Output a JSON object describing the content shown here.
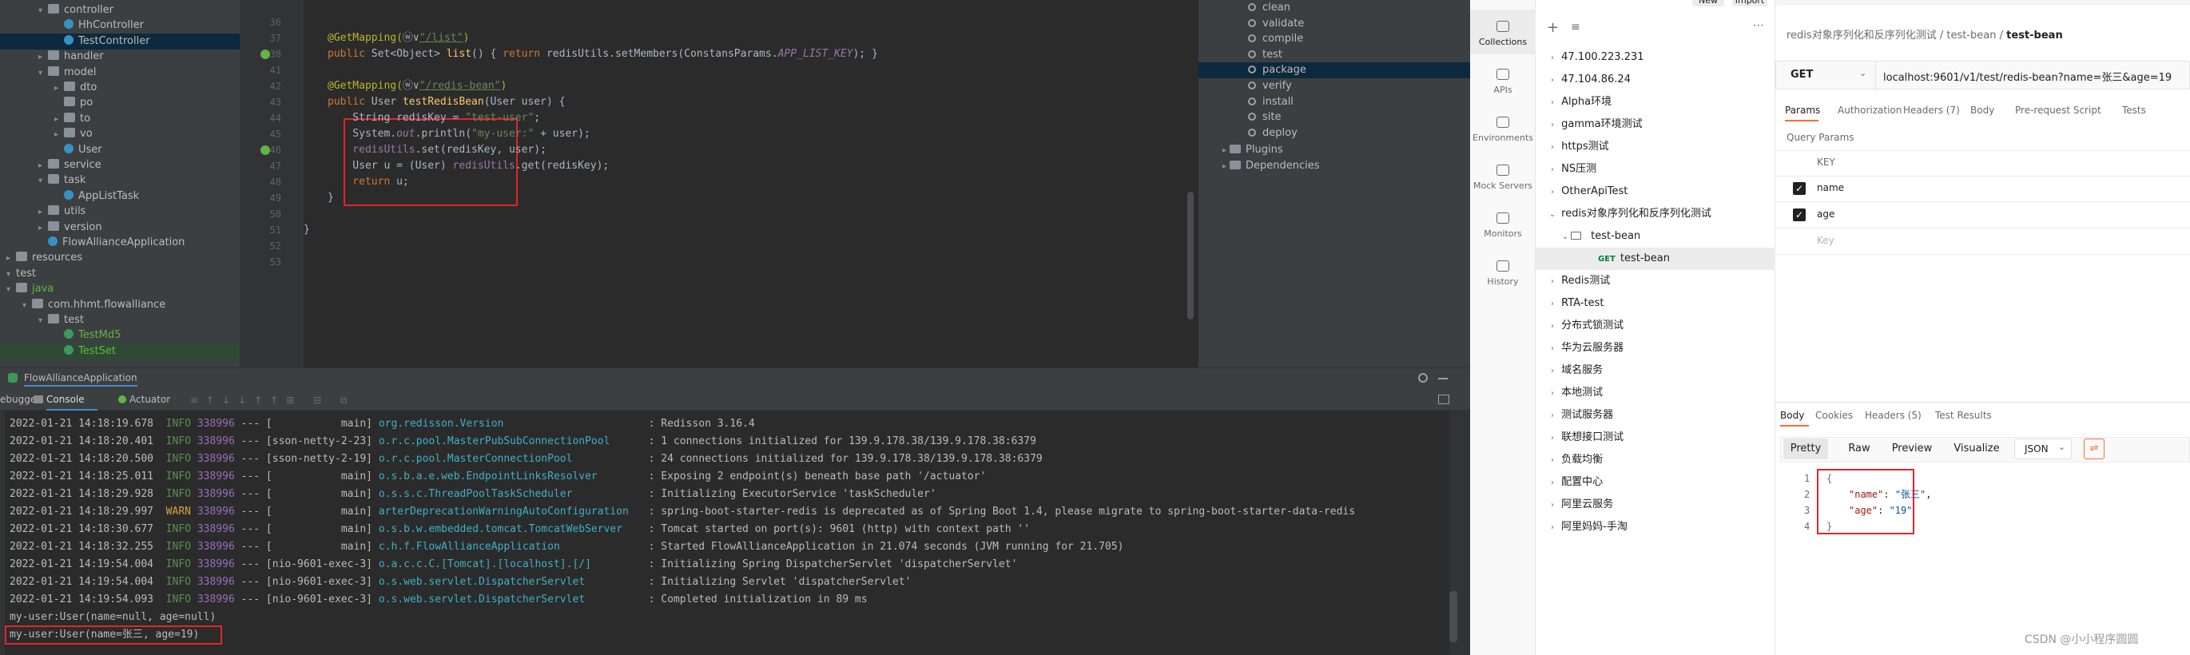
{
  "project_tree": [
    {
      "label": "controller",
      "depth": 2,
      "type": "folder",
      "arrow": "▾"
    },
    {
      "label": "HhController",
      "depth": 3,
      "type": "class",
      "arrow": ""
    },
    {
      "label": "TestController",
      "depth": 3,
      "type": "class",
      "arrow": "",
      "selected": true
    },
    {
      "label": "handler",
      "depth": 2,
      "type": "folder",
      "arrow": "▸"
    },
    {
      "label": "model",
      "depth": 2,
      "type": "folder",
      "arrow": "▾"
    },
    {
      "label": "dto",
      "depth": 3,
      "type": "folder",
      "arrow": "▸"
    },
    {
      "label": "po",
      "depth": 3,
      "type": "folder",
      "arrow": ""
    },
    {
      "label": "to",
      "depth": 3,
      "type": "folder",
      "arrow": "▸"
    },
    {
      "label": "vo",
      "depth": 3,
      "type": "folder",
      "arrow": "▸"
    },
    {
      "label": "User",
      "depth": 3,
      "type": "class",
      "arrow": ""
    },
    {
      "label": "service",
      "depth": 2,
      "type": "folder",
      "arrow": "▸"
    },
    {
      "label": "task",
      "depth": 2,
      "type": "folder",
      "arrow": "▾"
    },
    {
      "label": "AppListTask",
      "depth": 3,
      "type": "class",
      "arrow": ""
    },
    {
      "label": "utils",
      "depth": 2,
      "type": "folder",
      "arrow": "▸"
    },
    {
      "label": "version",
      "depth": 2,
      "type": "folder",
      "arrow": "▸"
    },
    {
      "label": "FlowAllianceApplication",
      "depth": 2,
      "type": "class",
      "arrow": ""
    },
    {
      "label": "resources",
      "depth": 0,
      "type": "folder",
      "arrow": "▸"
    },
    {
      "label": "test",
      "depth": 0,
      "type": "plain",
      "arrow": "▾"
    },
    {
      "label": "java",
      "depth": 0,
      "type": "folder-green",
      "arrow": "▾"
    },
    {
      "label": "com.hhmt.flowalliance",
      "depth": 1,
      "type": "folder",
      "arrow": "▾"
    },
    {
      "label": "test",
      "depth": 2,
      "type": "folder",
      "arrow": "▾"
    },
    {
      "label": "TestMd5",
      "depth": 3,
      "type": "class-green",
      "arrow": ""
    },
    {
      "label": "TestSet",
      "depth": 3,
      "type": "class-green",
      "arrow": ""
    }
  ],
  "editor": {
    "line_numbers": [
      "36",
      "37",
      "38",
      "41",
      "42",
      "43",
      "44",
      "45",
      "46",
      "47",
      "48",
      "49",
      "50",
      "51",
      "52",
      "53"
    ],
    "lines": [
      {
        "n": "36",
        "parts": []
      },
      {
        "n": "37",
        "parts": [
          {
            "c": "an",
            "t": "@GetMapping("
          },
          {
            "c": "",
            "t": "ⓦ∨"
          },
          {
            "c": "link",
            "t": "\"/list\""
          },
          {
            "c": "an",
            "t": ")"
          }
        ]
      },
      {
        "n": "38",
        "parts": [
          {
            "c": "kw",
            "t": "public "
          },
          {
            "c": "",
            "t": "Set<Object> "
          },
          {
            "c": "mth",
            "t": "list"
          },
          {
            "c": "",
            "t": "() { "
          },
          {
            "c": "kw",
            "t": "return "
          },
          {
            "c": "",
            "t": "redisUtils.setMembers(ConstansParams."
          },
          {
            "c": "fld",
            "t": "APP_LIST_KEY"
          },
          {
            "c": "",
            "t": "); }"
          }
        ]
      },
      {
        "n": "41",
        "parts": []
      },
      {
        "n": "42",
        "parts": [
          {
            "c": "an",
            "t": "@GetMapping("
          },
          {
            "c": "",
            "t": "ⓦ∨"
          },
          {
            "c": "link",
            "t": "\"/redis-bean\""
          },
          {
            "c": "an",
            "t": ")"
          }
        ]
      },
      {
        "n": "43",
        "parts": [
          {
            "c": "kw",
            "t": "public "
          },
          {
            "c": "",
            "t": "User "
          },
          {
            "c": "mth",
            "t": "testRedisBean"
          },
          {
            "c": "",
            "t": "(User user) {"
          }
        ]
      },
      {
        "n": "44",
        "parts": [
          {
            "c": "",
            "t": "    String redisKey = "
          },
          {
            "c": "str",
            "t": "\"test-user\""
          },
          {
            "c": "",
            "t": ";"
          }
        ]
      },
      {
        "n": "45",
        "parts": [
          {
            "c": "",
            "t": "    System."
          },
          {
            "c": "fld",
            "t": "out"
          },
          {
            "c": "",
            "t": ".println("
          },
          {
            "c": "str",
            "t": "\"my-user:\""
          },
          {
            "c": "",
            "t": " + user);"
          }
        ]
      },
      {
        "n": "46",
        "parts": [
          {
            "c": "var",
            "t": "    redisUtils"
          },
          {
            "c": "",
            "t": ".set(redisKey, user);"
          }
        ]
      },
      {
        "n": "47",
        "parts": [
          {
            "c": "",
            "t": "    User u = (User) "
          },
          {
            "c": "var",
            "t": "redisUtils"
          },
          {
            "c": "",
            "t": ".get(redisKey);"
          }
        ]
      },
      {
        "n": "48",
        "parts": [
          {
            "c": "kw",
            "t": "    return "
          },
          {
            "c": "",
            "t": "u;"
          }
        ]
      },
      {
        "n": "49",
        "parts": [
          {
            "c": "",
            "t": "}"
          }
        ]
      },
      {
        "n": "50",
        "parts": []
      },
      {
        "n": "51",
        "parts": [
          {
            "c": "",
            "t": "}"
          }
        ]
      },
      {
        "n": "52",
        "parts": []
      },
      {
        "n": "53",
        "parts": []
      }
    ]
  },
  "maven": {
    "lifecycle": [
      "clean",
      "validate",
      "compile",
      "test",
      "package",
      "verify",
      "install",
      "site",
      "deploy"
    ],
    "selected": "package",
    "folders": [
      "Plugins",
      "Dependencies"
    ]
  },
  "run": {
    "app_name": "FlowAllianceApplication",
    "tabs": [
      "ebugger",
      "Console",
      "Actuator"
    ]
  },
  "console_lines": [
    {
      "ts": "2022-01-21 14:18:19.678",
      "lvl": "INFO",
      "pid": "338996",
      "thread": "--- [           main]",
      "logger": "org.redisson.Version",
      "msg": ": Redisson 3.16.4"
    },
    {
      "ts": "2022-01-21 14:18:20.401",
      "lvl": "INFO",
      "pid": "338996",
      "thread": "--- [sson-netty-2-23]",
      "logger": "o.r.c.pool.MasterPubSubConnectionPool",
      "msg": ": 1 connections initialized for 139.9.178.38/139.9.178.38:6379"
    },
    {
      "ts": "2022-01-21 14:18:20.500",
      "lvl": "INFO",
      "pid": "338996",
      "thread": "--- [sson-netty-2-19]",
      "logger": "o.r.c.pool.MasterConnectionPool",
      "msg": ": 24 connections initialized for 139.9.178.38/139.9.178.38:6379"
    },
    {
      "ts": "2022-01-21 14:18:25.011",
      "lvl": "INFO",
      "pid": "338996",
      "thread": "--- [           main]",
      "logger": "o.s.b.a.e.web.EndpointLinksResolver",
      "msg": ": Exposing 2 endpoint(s) beneath base path '/actuator'"
    },
    {
      "ts": "2022-01-21 14:18:29.928",
      "lvl": "INFO",
      "pid": "338996",
      "thread": "--- [           main]",
      "logger": "o.s.s.c.ThreadPoolTaskScheduler",
      "msg": ": Initializing ExecutorService 'taskScheduler'"
    },
    {
      "ts": "2022-01-21 14:18:29.997",
      "lvl": "WARN",
      "pid": "338996",
      "thread": "--- [           main]",
      "logger": "arterDeprecationWarningAutoConfiguration",
      "msg": ": spring-boot-starter-redis is deprecated as of Spring Boot 1.4, please migrate to spring-boot-starter-data-redis"
    },
    {
      "ts": "2022-01-21 14:18:30.677",
      "lvl": "INFO",
      "pid": "338996",
      "thread": "--- [           main]",
      "logger": "o.s.b.w.embedded.tomcat.TomcatWebServer",
      "msg": ": Tomcat started on port(s): 9601 (http) with context path ''"
    },
    {
      "ts": "2022-01-21 14:18:32.255",
      "lvl": "INFO",
      "pid": "338996",
      "thread": "--- [           main]",
      "logger": "c.h.f.FlowAllianceApplication",
      "msg": ": Started FlowAllianceApplication in 21.074 seconds (JVM running for 21.705)"
    },
    {
      "ts": "2022-01-21 14:19:54.004",
      "lvl": "INFO",
      "pid": "338996",
      "thread": "--- [nio-9601-exec-3]",
      "logger": "o.a.c.c.C.[Tomcat].[localhost].[/]",
      "msg": ": Initializing Spring DispatcherServlet 'dispatcherServlet'"
    },
    {
      "ts": "2022-01-21 14:19:54.004",
      "lvl": "INFO",
      "pid": "338996",
      "thread": "--- [nio-9601-exec-3]",
      "logger": "o.s.web.servlet.DispatcherServlet",
      "msg": ": Initializing Servlet 'dispatcherServlet'"
    },
    {
      "ts": "2022-01-21 14:19:54.093",
      "lvl": "INFO",
      "pid": "338996",
      "thread": "--- [nio-9601-exec-3]",
      "logger": "o.s.web.servlet.DispatcherServlet",
      "msg": ": Completed initialization in 89 ms"
    }
  ],
  "console_plain": [
    "my-user:User(name=null, age=null)",
    "my-user:User(name=张三, age=19)"
  ],
  "postman": {
    "top_buttons": [
      "New",
      "Import"
    ],
    "side_icons": [
      "Collections",
      "APIs",
      "Environments",
      "Mock Servers",
      "Monitors",
      "History"
    ],
    "collections": [
      {
        "label": "47.100.223.231",
        "level": 0,
        "chev": "›"
      },
      {
        "label": "47.104.86.24",
        "level": 0,
        "chev": "›"
      },
      {
        "label": "Alpha环境",
        "level": 0,
        "chev": "›"
      },
      {
        "label": "gamma环境测试",
        "level": 0,
        "chev": "›"
      },
      {
        "label": "https测试",
        "level": 0,
        "chev": "›"
      },
      {
        "label": "NS压测",
        "level": 0,
        "chev": "›"
      },
      {
        "label": "OtherApiTest",
        "level": 0,
        "chev": "›"
      },
      {
        "label": "redis对象序列化和反序列化测试",
        "level": 0,
        "chev": "⌄"
      },
      {
        "label": "test-bean",
        "level": 1,
        "chev": "⌄"
      },
      {
        "label": "test-bean",
        "level": 2,
        "chev": "",
        "method": "GET"
      },
      {
        "label": "Redis测试",
        "level": 0,
        "chev": "›"
      },
      {
        "label": "RTA-test",
        "level": 0,
        "chev": "›"
      },
      {
        "label": "分布式锁测试",
        "level": 0,
        "chev": "›"
      },
      {
        "label": "华为云服务器",
        "level": 0,
        "chev": "›"
      },
      {
        "label": "域名服务",
        "level": 0,
        "chev": "›"
      },
      {
        "label": "本地测试",
        "level": 0,
        "chev": "›"
      },
      {
        "label": "测试服务器",
        "level": 0,
        "chev": "›"
      },
      {
        "label": "联想接口测试",
        "level": 0,
        "chev": "›"
      },
      {
        "label": "负载均衡",
        "level": 0,
        "chev": "›"
      },
      {
        "label": "配置中心",
        "level": 0,
        "chev": "›"
      },
      {
        "label": "阿里云服务",
        "level": 0,
        "chev": "›"
      },
      {
        "label": "阿里妈妈-手淘",
        "level": 0,
        "chev": "›"
      }
    ],
    "breadcrumb": [
      "redis对象序列化和反序列化测试",
      "/",
      "test-bean",
      "/",
      "test-bean"
    ],
    "method": "GET",
    "url": "localhost:9601/v1/test/redis-bean?name=张三&age=19",
    "req_tabs": [
      "Params",
      "Authorization",
      "Headers (7)",
      "Body",
      "Pre-request Script",
      "Tests"
    ],
    "query_params_title": "Query Params",
    "params_header": "KEY",
    "params": [
      "name",
      "age"
    ],
    "params_placeholder": "Key",
    "resp_tabs": [
      "Body",
      "Cookies",
      "Headers (5)",
      "Test Results"
    ],
    "resp_views": [
      "Pretty",
      "Raw",
      "Preview",
      "Visualize"
    ],
    "format": "JSON",
    "response_lines": [
      "1",
      "2",
      "3",
      "4"
    ],
    "response_json": {
      "name_key": "\"name\"",
      "name_val": "\"张三\"",
      "age_key": "\"age\"",
      "age_val": "\"19\""
    },
    "watermark": "CSDN @小小程序圆圆"
  },
  "colors": {
    "accent": "#ff6c37",
    "highlight_box": "#e0252a",
    "ide_bg": "#2b2b2b"
  }
}
